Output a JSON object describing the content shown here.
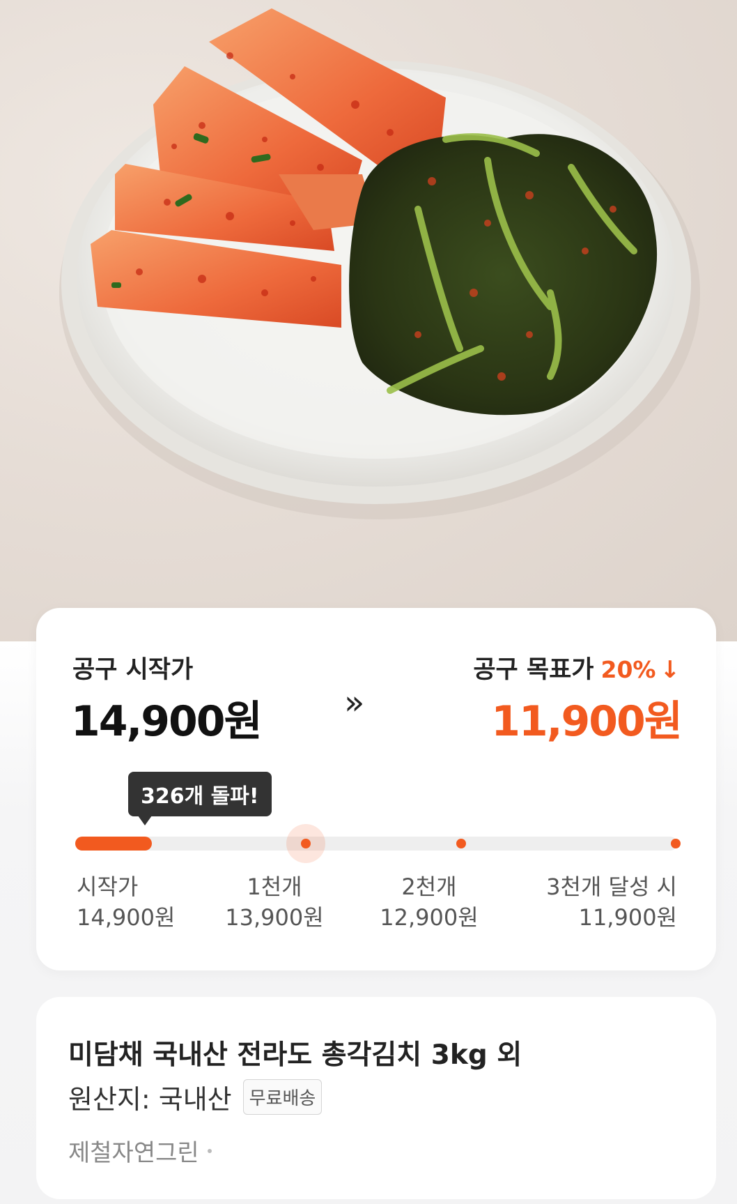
{
  "hero": {
    "image": "kimchi-dish-photo"
  },
  "price": {
    "start_label": "공구 시작가",
    "start_price": "14,900원",
    "arrow_icon": "»",
    "target_label": "공구 목표가",
    "discount": "20%",
    "discount_arrow": "↓",
    "target_price": "11,900원",
    "accent_color": "#f25a1f"
  },
  "progress": {
    "tooltip": "326개 돌파!",
    "sold_count": 326,
    "max_count": 3000,
    "milestones": [
      {
        "name": "시작가",
        "price": "14,900원"
      },
      {
        "name": "1천개",
        "price": "13,900원"
      },
      {
        "name": "2천개",
        "price": "12,900원"
      },
      {
        "name": "3천개 달성 시",
        "price": "11,900원"
      }
    ]
  },
  "product": {
    "title": "미담채 국내산 전라도 총각김치 3kg 외",
    "origin": "원산지: 국내산",
    "shipping_badge": "무료배송",
    "seller": "제철자연그린"
  }
}
